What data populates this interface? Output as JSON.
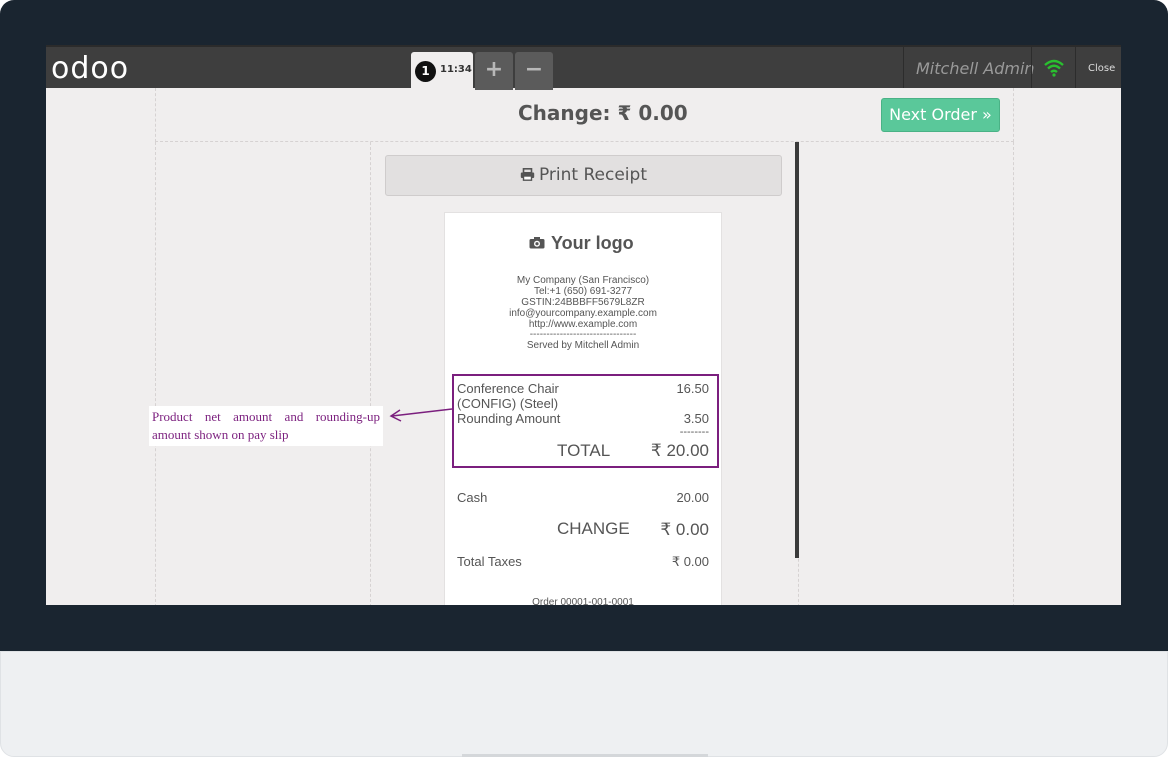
{
  "navbar": {
    "logo": "odoo",
    "order_tab": {
      "number": "1",
      "time": "11:34"
    },
    "add_label": "+",
    "remove_label": "−",
    "user": "Mitchell Admin",
    "close_label": "Close"
  },
  "payment_screen": {
    "change_title": "Change: ₹ 0.00",
    "next_order_label": "Next Order »",
    "print_receipt_label": "Print Receipt"
  },
  "receipt": {
    "logo_text": "Your logo",
    "company_lines": [
      "My Company (San Francisco)",
      "Tel:+1 (650) 691-3277",
      "GSTIN:24BBBFF5679L8ZR",
      "info@yourcompany.example.com",
      "http://www.example.com",
      "--------------------------------",
      "Served by Mitchell Admin"
    ],
    "lines": [
      {
        "name": "Conference Chair",
        "name2": "(CONFIG) (Steel)",
        "amount": "16.50"
      },
      {
        "name": "Rounding Amount",
        "amount": "3.50"
      }
    ],
    "separator": "--------",
    "total_label": "TOTAL",
    "total_value": "₹ 20.00",
    "payment_label": "Cash",
    "payment_value": "20.00",
    "change_label": "CHANGE",
    "change_value": "₹ 0.00",
    "taxes_label": "Total Taxes",
    "taxes_value": "₹ 0.00",
    "order_ref": "Order 00001-001-0001"
  },
  "annotation": {
    "text": "Product net amount and rounding-up amount shown on pay slip",
    "color": "#7b1f7e"
  },
  "colors": {
    "navbar_bg": "#3e3e3e",
    "accent_green": "#5ac89a",
    "wifi_green": "#29c02f",
    "screen_bg": "#f0eeee"
  }
}
